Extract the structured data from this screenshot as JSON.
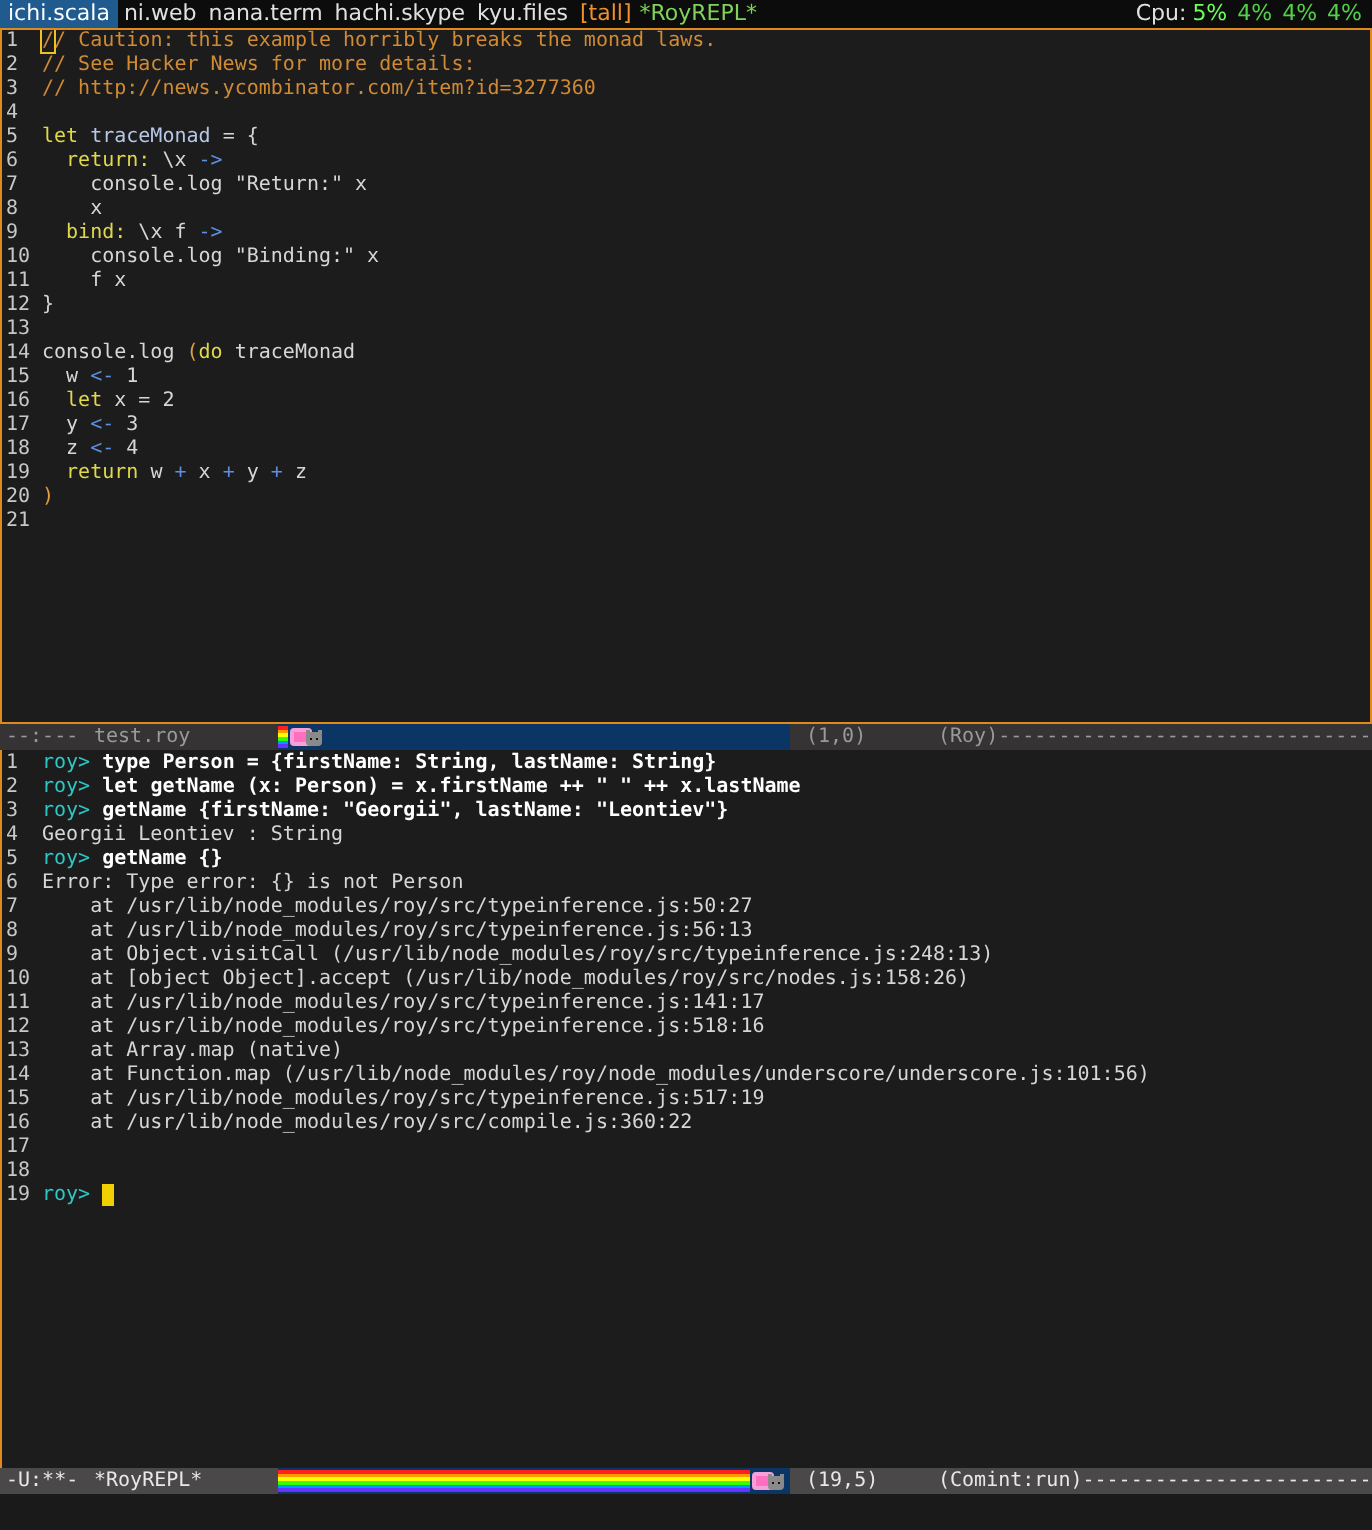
{
  "top_bar": {
    "tabs": [
      {
        "label": "ichi.scala",
        "selected": true
      },
      {
        "label": "ni.web",
        "selected": false
      },
      {
        "label": "nana.term",
        "selected": false
      },
      {
        "label": "hachi.skype",
        "selected": false
      },
      {
        "label": "kyu.files",
        "selected": false
      }
    ],
    "layout": "[tall]",
    "window": "*RoyREPL*",
    "cpu_label": "Cpu:",
    "cpu": [
      "5%",
      "4%",
      "4%",
      "4%"
    ]
  },
  "editor": {
    "lines": [
      {
        "number": "1",
        "tokens": [
          {
            "kind": "cursor",
            "text": "/"
          },
          {
            "kind": "comment",
            "text": "/ Caution: this example horribly breaks the monad laws."
          }
        ]
      },
      {
        "number": "2",
        "tokens": [
          {
            "kind": "comment",
            "text": "// See Hacker News for more details:"
          }
        ]
      },
      {
        "number": "3",
        "tokens": [
          {
            "kind": "comment",
            "text": "// http://news.ycombinator.com/item?id=3277360"
          }
        ]
      },
      {
        "number": "4"
      },
      {
        "number": "5",
        "tokens": [
          {
            "kind": "keyword",
            "text": "let"
          },
          {
            "kind": "name",
            "text": " traceMonad"
          },
          {
            "kind": "plain",
            "text": " = {"
          }
        ]
      },
      {
        "number": "6",
        "tokens": [
          {
            "kind": "keyword",
            "text": "  return:"
          },
          {
            "kind": "plain",
            "text": " \\x "
          },
          {
            "kind": "operator",
            "text": "->"
          }
        ]
      },
      {
        "number": "7",
        "tokens": [
          {
            "kind": "plain",
            "text": "    console.log \"Return:\" x"
          }
        ]
      },
      {
        "number": "8",
        "tokens": [
          {
            "kind": "plain",
            "text": "    x"
          }
        ]
      },
      {
        "number": "9",
        "tokens": [
          {
            "kind": "keyword",
            "text": "  bind:"
          },
          {
            "kind": "plain",
            "text": " \\x f "
          },
          {
            "kind": "operator",
            "text": "->"
          }
        ]
      },
      {
        "number": "10",
        "tokens": [
          {
            "kind": "plain",
            "text": "    console.log \"Binding:\" x"
          }
        ]
      },
      {
        "number": "11",
        "tokens": [
          {
            "kind": "plain",
            "text": "    f x"
          }
        ]
      },
      {
        "number": "12",
        "tokens": [
          {
            "kind": "plain",
            "text": "}"
          }
        ]
      },
      {
        "number": "13"
      },
      {
        "number": "14",
        "tokens": [
          {
            "kind": "plain",
            "text": "console.log "
          },
          {
            "kind": "paren",
            "text": "("
          },
          {
            "kind": "keyword",
            "text": "do"
          },
          {
            "kind": "plain",
            "text": " traceMonad"
          }
        ]
      },
      {
        "number": "15",
        "tokens": [
          {
            "kind": "plain",
            "text": "  w "
          },
          {
            "kind": "operator",
            "text": "<-"
          },
          {
            "kind": "plain",
            "text": " 1"
          }
        ]
      },
      {
        "number": "16",
        "tokens": [
          {
            "kind": "keyword",
            "text": "  let"
          },
          {
            "kind": "plain",
            "text": " x = 2"
          }
        ]
      },
      {
        "number": "17",
        "tokens": [
          {
            "kind": "plain",
            "text": "  y "
          },
          {
            "kind": "operator",
            "text": "<-"
          },
          {
            "kind": "plain",
            "text": " 3"
          }
        ]
      },
      {
        "number": "18",
        "tokens": [
          {
            "kind": "plain",
            "text": "  z "
          },
          {
            "kind": "operator",
            "text": "<-"
          },
          {
            "kind": "plain",
            "text": " 4"
          }
        ]
      },
      {
        "number": "19",
        "tokens": [
          {
            "kind": "keyword",
            "text": "  return"
          },
          {
            "kind": "plain",
            "text": " w "
          },
          {
            "kind": "operator",
            "text": "+"
          },
          {
            "kind": "plain",
            "text": " x "
          },
          {
            "kind": "operator",
            "text": "+"
          },
          {
            "kind": "plain",
            "text": " y "
          },
          {
            "kind": "operator",
            "text": "+"
          },
          {
            "kind": "plain",
            "text": " z"
          }
        ]
      },
      {
        "number": "20",
        "tokens": [
          {
            "kind": "paren",
            "text": ")"
          }
        ]
      },
      {
        "number": "21"
      }
    ]
  },
  "editor_mode_line": {
    "flags": "--:---",
    "buffer": "test.roy",
    "progress": {
      "level": 0.02
    },
    "position": "(1,0)",
    "mode": "(Roy)",
    "fill": "-------------------------------"
  },
  "repl": {
    "lines": [
      {
        "number": "1",
        "cursor": false,
        "tokens": [
          {
            "kind": "prompt",
            "text": "roy>"
          },
          {
            "kind": "input",
            "text": " type Person = {firstName: String, lastName: String}"
          }
        ]
      },
      {
        "number": "2",
        "cursor": false,
        "tokens": [
          {
            "kind": "prompt",
            "text": "roy>"
          },
          {
            "kind": "input",
            "text": " let getName (x: Person) = x.firstName ++ \" \" ++ x.lastName"
          }
        ]
      },
      {
        "number": "3",
        "cursor": false,
        "tokens": [
          {
            "kind": "prompt",
            "text": "roy>"
          },
          {
            "kind": "input",
            "text": " getName {firstName: \"Georgii\", lastName: \"Leontiev\"}"
          }
        ]
      },
      {
        "number": "4",
        "cursor": false,
        "tokens": [
          {
            "kind": "output",
            "text": "Georgii Leontiev : String"
          }
        ]
      },
      {
        "number": "5",
        "cursor": false,
        "tokens": [
          {
            "kind": "prompt",
            "text": "roy>"
          },
          {
            "kind": "input",
            "text": " getName {}"
          }
        ]
      },
      {
        "number": "6",
        "cursor": false,
        "tokens": [
          {
            "kind": "output",
            "text": "Error: Type error: {} is not Person"
          }
        ]
      },
      {
        "number": "7",
        "cursor": false,
        "tokens": [
          {
            "kind": "output",
            "text": "    at /usr/lib/node_modules/roy/src/typeinference.js:50:27"
          }
        ]
      },
      {
        "number": "8",
        "cursor": false,
        "tokens": [
          {
            "kind": "output",
            "text": "    at /usr/lib/node_modules/roy/src/typeinference.js:56:13"
          }
        ]
      },
      {
        "number": "9",
        "cursor": false,
        "tokens": [
          {
            "kind": "output",
            "text": "    at Object.visitCall (/usr/lib/node_modules/roy/src/typeinference.js:248:13)"
          }
        ]
      },
      {
        "number": "10",
        "cursor": false,
        "tokens": [
          {
            "kind": "output",
            "text": "    at [object Object].accept (/usr/lib/node_modules/roy/src/nodes.js:158:26)"
          }
        ]
      },
      {
        "number": "11",
        "cursor": false,
        "tokens": [
          {
            "kind": "output",
            "text": "    at /usr/lib/node_modules/roy/src/typeinference.js:141:17"
          }
        ]
      },
      {
        "number": "12",
        "cursor": false,
        "tokens": [
          {
            "kind": "output",
            "text": "    at /usr/lib/node_modules/roy/src/typeinference.js:518:16"
          }
        ]
      },
      {
        "number": "13",
        "cursor": false,
        "tokens": [
          {
            "kind": "output",
            "text": "    at Array.map (native)"
          }
        ]
      },
      {
        "number": "14",
        "cursor": false,
        "tokens": [
          {
            "kind": "output",
            "text": "    at Function.map (/usr/lib/node_modules/roy/node_modules/underscore/underscore.js:101:56)"
          }
        ]
      },
      {
        "number": "15",
        "cursor": false,
        "tokens": [
          {
            "kind": "output",
            "text": "    at /usr/lib/node_modules/roy/src/typeinference.js:517:19"
          }
        ]
      },
      {
        "number": "16",
        "cursor": false,
        "tokens": [
          {
            "kind": "output",
            "text": "    at /usr/lib/node_modules/roy/src/compile.js:360:22"
          }
        ]
      },
      {
        "number": "17",
        "cursor": false
      },
      {
        "number": "18",
        "cursor": false
      },
      {
        "number": "19",
        "cursor": true,
        "tokens": [
          {
            "kind": "prompt",
            "text": "roy>"
          }
        ]
      }
    ]
  },
  "repl_mode_line": {
    "flags": "-U:**-",
    "buffer": "*RoyREPL*",
    "progress": {
      "level": 0.92
    },
    "position": "(19,5)",
    "mode": "(Comint:run)",
    "fill": "------------------------"
  }
}
